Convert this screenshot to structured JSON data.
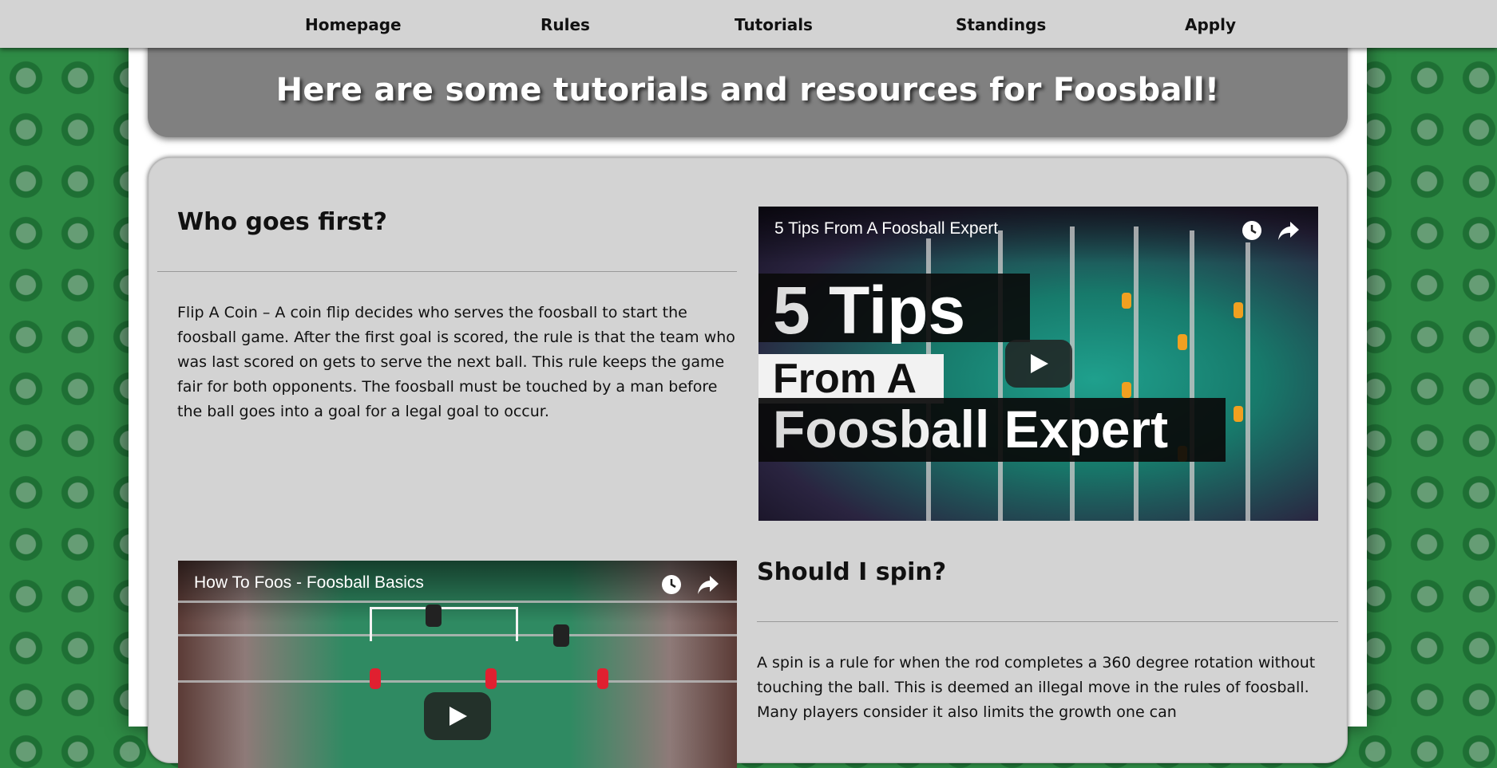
{
  "nav": {
    "items": [
      {
        "label": "Homepage"
      },
      {
        "label": "Rules"
      },
      {
        "label": "Tutorials"
      },
      {
        "label": "Standings"
      },
      {
        "label": "Apply"
      }
    ]
  },
  "banner": {
    "title": "Here are some tutorials and resources for Foosball!"
  },
  "sections": [
    {
      "title": "Who goes first?",
      "text": "Flip A Coin – A coin flip decides who serves the foosball to start the foosball game. After the first goal is scored, the rule is that the team who was last scored on gets to serve the next ball. This rule keeps the game fair for both opponents. The foosball must be touched by a man before the ball goes into a goal for a legal goal to occur."
    },
    {
      "title": "Should I spin?",
      "text": "A spin is a rule for when the rod completes a 360 degree rotation without touching the ball. This is deemed an illegal move in the rules of foosball. Many players consider it also limits the growth one can"
    }
  ],
  "videos": [
    {
      "title": "5 Tips From A Foosball Expert",
      "thumb_line1": "5 Tips",
      "thumb_line2": "From A",
      "thumb_line3": "Foosball Expert",
      "icons": [
        "clock-icon",
        "share-icon",
        "play-icon"
      ]
    },
    {
      "title": "How To Foos - Foosball Basics",
      "icons": [
        "clock-icon",
        "share-icon",
        "play-icon"
      ]
    }
  ],
  "colors": {
    "navbar": "#d3d3d3",
    "banner": "#808080",
    "content": "#d3d3d3",
    "background": "#2e8b45"
  }
}
